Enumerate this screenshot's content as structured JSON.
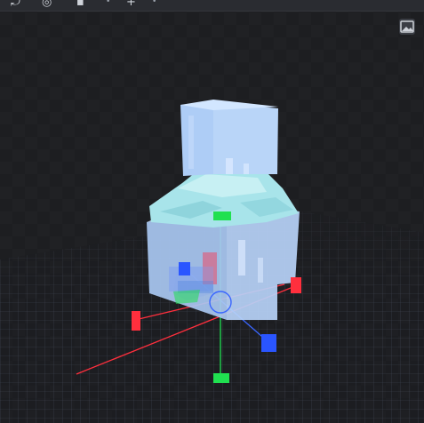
{
  "toolbar": {
    "buttons": [
      {
        "name": "undo-icon",
        "glyph": "⤾"
      },
      {
        "name": "target-icon",
        "glyph": "◎"
      },
      {
        "name": "gizmo-mode-icon",
        "glyph": "▪"
      },
      {
        "name": "move-icon",
        "glyph": "+"
      }
    ]
  },
  "viewport": {
    "screenshot_button": {
      "icon": "image-icon"
    },
    "gizmo_colors": {
      "x": "#ff2f3d",
      "y": "#20e050",
      "z": "#2a55ff"
    },
    "model_color": "#a9c8f2",
    "collar_color": "#a8e4ea"
  }
}
